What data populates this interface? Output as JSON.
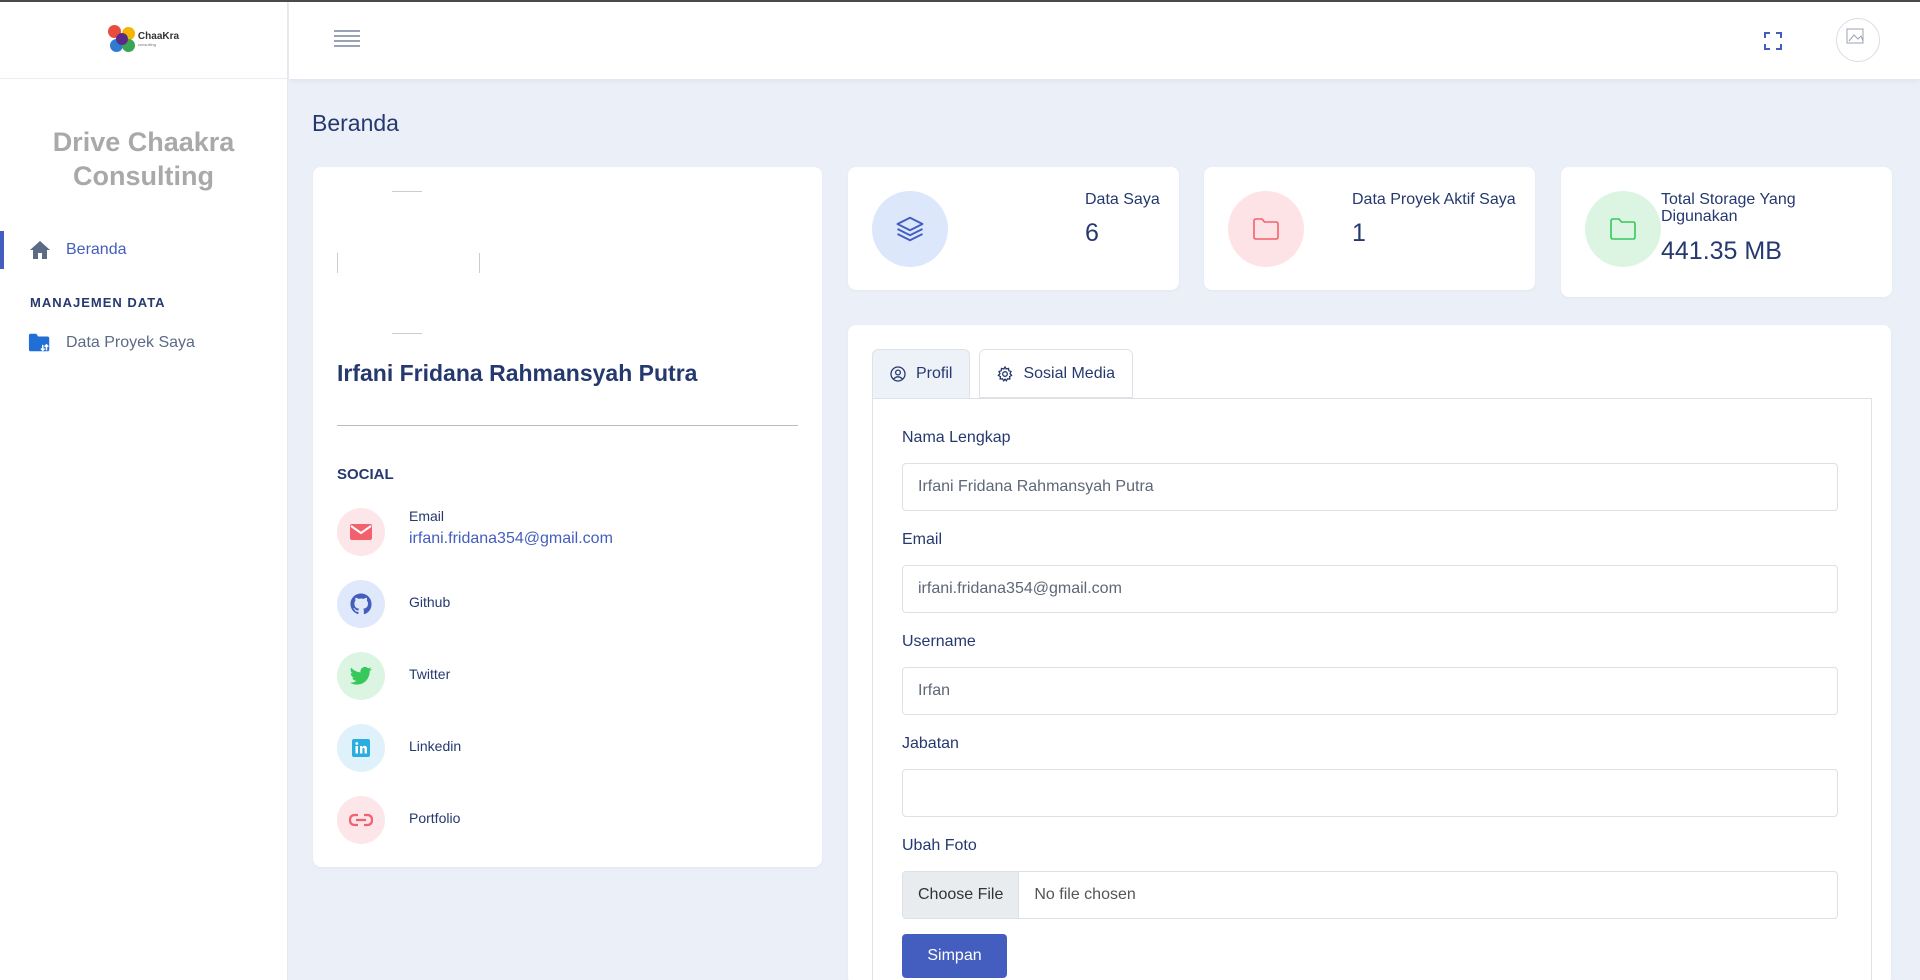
{
  "brand": {
    "logo_text": "ChaaKra",
    "logo_subtext": "consulting",
    "app_title": "Drive Chaakra Consulting"
  },
  "sidebar": {
    "items": [
      {
        "label": "Beranda",
        "icon": "home-icon",
        "active": true
      },
      {
        "label": "Data Proyek Saya",
        "icon": "folder-sync-icon",
        "active": false
      }
    ],
    "section_label": "MANAJEMEN DATA"
  },
  "header": {
    "menu_icon": "hamburger-icon",
    "fullscreen_icon": "fullscreen-icon",
    "avatar": "user-avatar"
  },
  "page": {
    "title": "Beranda"
  },
  "profile": {
    "name": "Irfani Fridana Rahmansyah Putra",
    "social_title": "SOCIAL",
    "socials": [
      {
        "label": "Email",
        "value": "irfani.fridana354@gmail.com",
        "icon": "mail-icon",
        "color": "#f3616d"
      },
      {
        "label": "Github",
        "value": "",
        "icon": "github-icon",
        "color": "#435ebe"
      },
      {
        "label": "Twitter",
        "value": "",
        "icon": "twitter-icon",
        "color": "#36c85a"
      },
      {
        "label": "Linkedin",
        "value": "",
        "icon": "linkedin-icon",
        "color": "#2aaee0"
      },
      {
        "label": "Portfolio",
        "value": "",
        "icon": "link-icon",
        "color": "#f3616d"
      }
    ]
  },
  "stats": [
    {
      "label": "Data Saya",
      "value": "6",
      "icon": "layers-icon",
      "color": "#435ebe"
    },
    {
      "label": "Data Proyek Aktif Saya",
      "value": "1",
      "icon": "folder-icon",
      "color": "#f3616d"
    },
    {
      "label": "Total Storage Yang Digunakan",
      "value": "441.35 MB",
      "icon": "folder-icon",
      "color": "#36c85a"
    }
  ],
  "form": {
    "tabs": [
      {
        "label": "Profil",
        "icon": "user-circle-icon",
        "active": true
      },
      {
        "label": "Sosial Media",
        "icon": "gear-icon",
        "active": false
      }
    ],
    "fields": {
      "nama_lengkap": {
        "label": "Nama Lengkap",
        "value": "Irfani Fridana Rahmansyah Putra"
      },
      "email": {
        "label": "Email",
        "value": "irfani.fridana354@gmail.com"
      },
      "username": {
        "label": "Username",
        "value": "Irfan"
      },
      "jabatan": {
        "label": "Jabatan",
        "value": ""
      },
      "ubah_foto": {
        "label": "Ubah Foto",
        "button": "Choose File",
        "status": "No file chosen"
      }
    },
    "submit_label": "Simpan"
  }
}
